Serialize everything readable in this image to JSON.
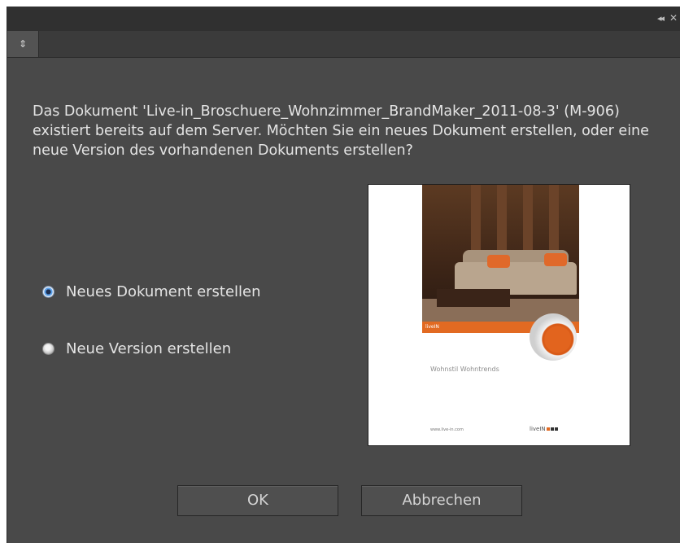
{
  "window": {
    "collapse_glyph": "◂◂",
    "close_glyph": "✕",
    "menu_glyph": "⇕"
  },
  "dialog": {
    "message": "Das Dokument 'Live-in_Broschuere_Wohnzimmer_BrandMaker_2011-08-3' (M-906) existiert bereits auf dem Server. Möchten Sie ein neues Dokument erstellen, oder eine neue Version des vorhandenen Dokuments erstellen?",
    "options": [
      {
        "label": "Neues Dokument erstellen",
        "selected": true
      },
      {
        "label": "Neue Version erstellen",
        "selected": false
      }
    ],
    "ok_label": "OK",
    "cancel_label": "Abbrechen"
  },
  "preview": {
    "band_text": "liveIN",
    "tagline": "Wohnstil Wohntrends",
    "url": "www.live-in.com",
    "logo": "liveIN"
  },
  "colors": {
    "panel_bg": "#494949",
    "accent_orange": "#e26a22",
    "radio_selected": "#5aa0ea"
  }
}
